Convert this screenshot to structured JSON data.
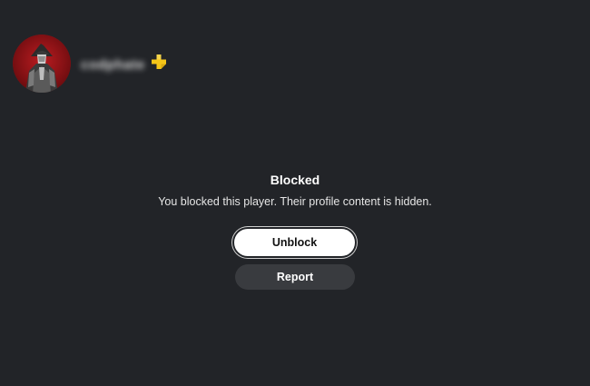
{
  "profile": {
    "username": "codphate",
    "avatar_icon": "hunter-avatar-icon",
    "membership_icon": "playstation-plus-icon",
    "membership_color": "#f5c518"
  },
  "blocked": {
    "title": "Blocked",
    "message": "You blocked this player. Their profile content is hidden."
  },
  "actions": {
    "unblock_label": "Unblock",
    "report_label": "Report"
  },
  "colors": {
    "background": "#222428",
    "primary_button": "#ffffff",
    "secondary_button": "#393b3f"
  }
}
